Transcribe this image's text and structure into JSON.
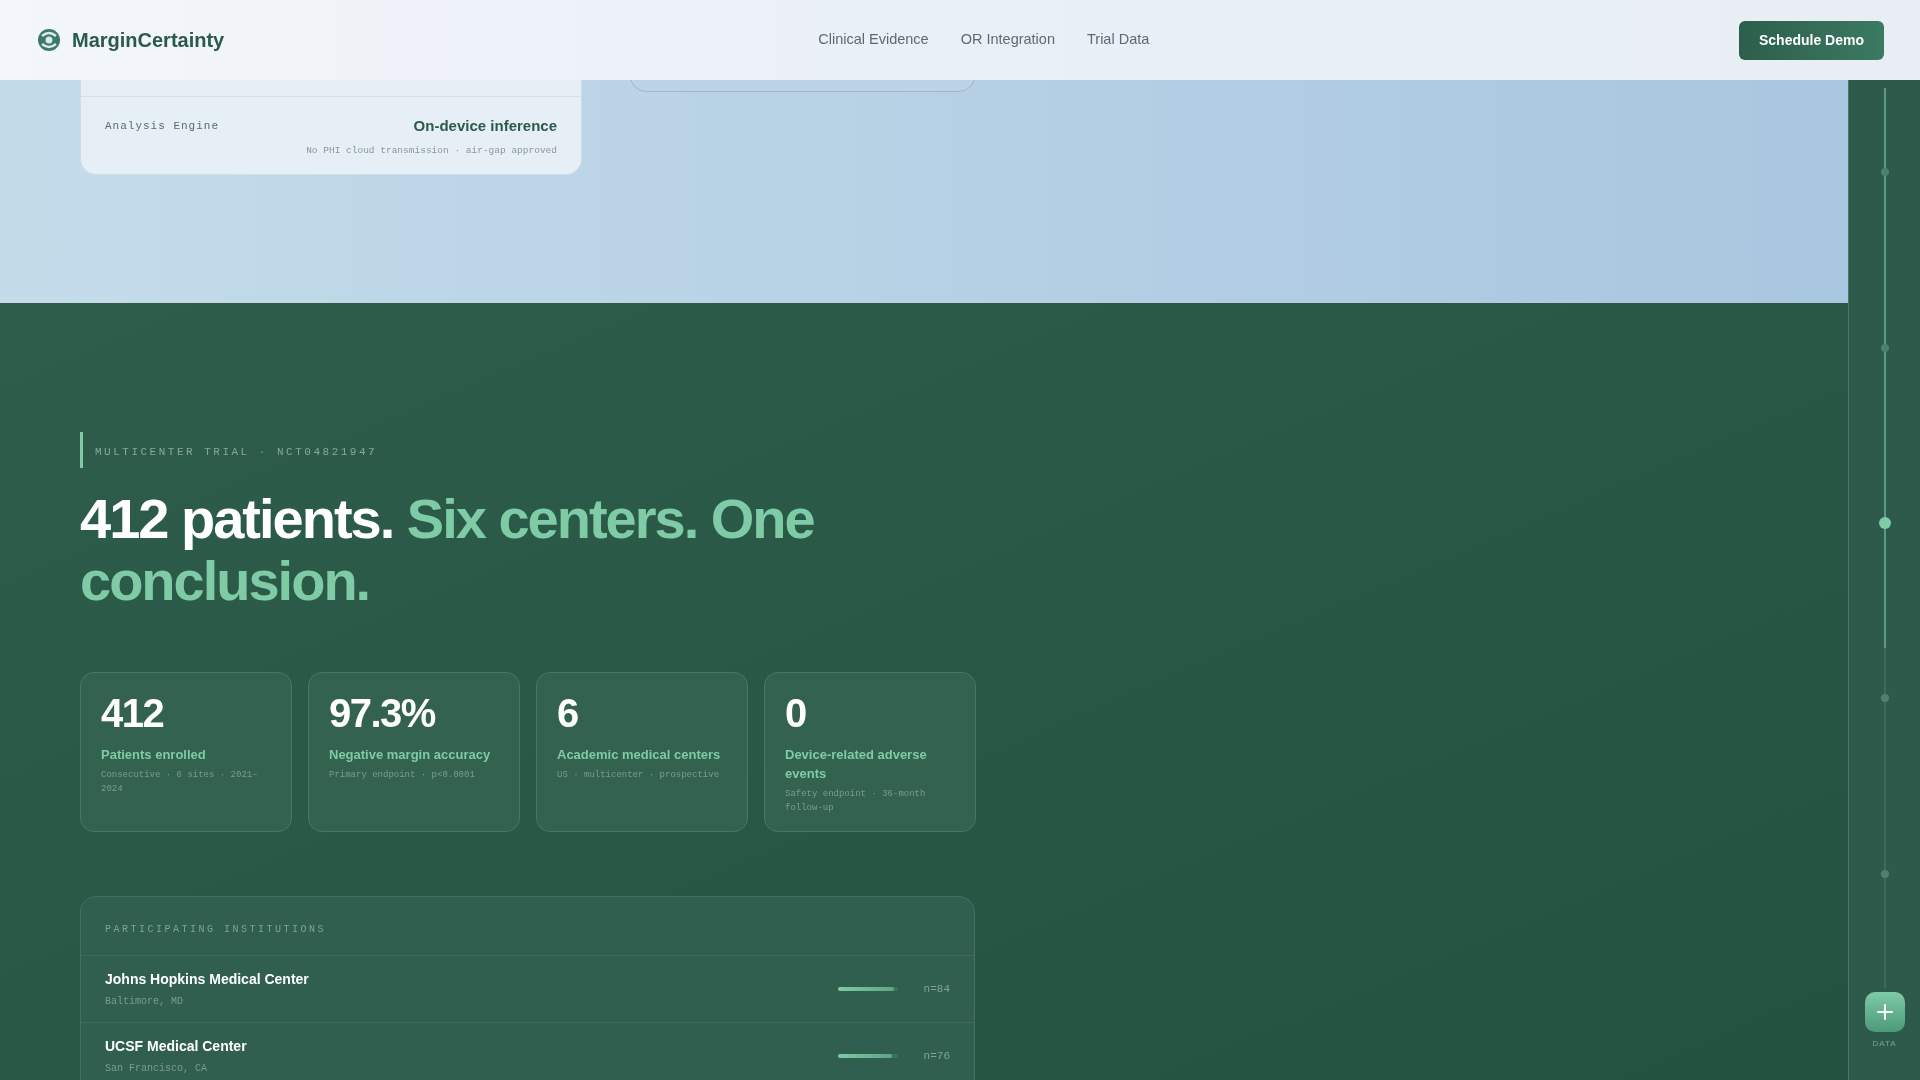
{
  "header": {
    "brand": "MarginCertainty",
    "nav": [
      {
        "label": "Clinical Evidence"
      },
      {
        "label": "OR Integration"
      },
      {
        "label": "Trial Data"
      }
    ],
    "cta": "Schedule Demo"
  },
  "spec_card": {
    "rows": [
      {
        "label": "Analysis Engine",
        "value": "On-device inference",
        "note": "No PHI cloud transmission · air-gap approved"
      }
    ]
  },
  "trial": {
    "eyebrow": "MULTICENTER TRIAL · NCT04821947",
    "headline_white": "412 patients.",
    "headline_green": "Six centers. One conclusion.",
    "stats": [
      {
        "value": "412",
        "label": "Patients enrolled",
        "note": "Consecutive · 6 sites · 2021–2024"
      },
      {
        "value": "97.3%",
        "label": "Negative margin accuracy",
        "note": "Primary endpoint · p<0.0001"
      },
      {
        "value": "6",
        "label": "Academic medical centers",
        "note": "US · multicenter · prospective"
      },
      {
        "value": "0",
        "label": "Device-related adverse events",
        "note": "Safety endpoint · 36-month follow-up"
      }
    ],
    "institutions": {
      "title": "PARTICIPATING INSTITUTIONS",
      "rows": [
        {
          "name": "Johns Hopkins Medical Center",
          "location": "Baltimore, MD",
          "level": 0.94,
          "count": "n=84"
        },
        {
          "name": "UCSF Medical Center",
          "location": "San Francisco, CA",
          "level": 0.9,
          "count": "n=76"
        }
      ]
    }
  },
  "rail": {
    "dots": [
      {
        "selected": false
      },
      {
        "selected": false
      },
      {
        "selected": true
      },
      {
        "selected": false
      },
      {
        "selected": false
      }
    ],
    "button_label": "DATA"
  }
}
